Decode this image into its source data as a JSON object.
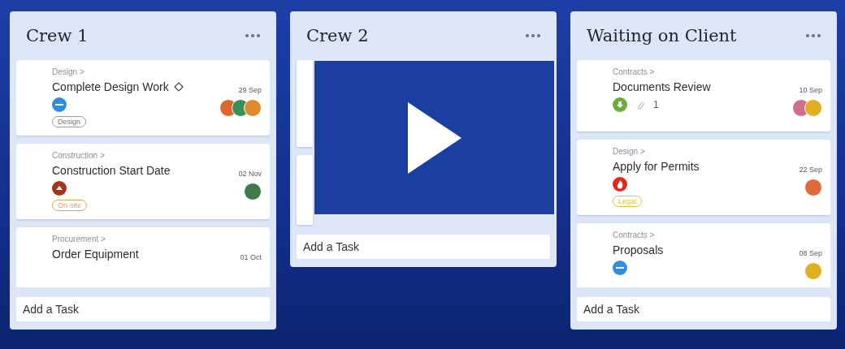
{
  "columns": [
    {
      "title": "Crew 1",
      "clipped": true,
      "cards": [
        {
          "category": "Design >",
          "title": "Complete Design Work",
          "milestone": true,
          "date": "29 Sep",
          "priority": {
            "kind": "minus",
            "color": "#2e8fe0"
          },
          "assignees": [
            {
              "color": "#e0662e"
            },
            {
              "color": "#3b8f5a"
            },
            {
              "color": "#e08a2e"
            }
          ],
          "tag": {
            "label": "Design",
            "color": "#9a9a9a"
          }
        },
        {
          "category": "Construction >",
          "title": "Construction Start Date",
          "date": "02 Nov",
          "priority": {
            "kind": "up",
            "color": "#a8321c"
          },
          "assignees": [
            {
              "color": "#3f7a4a"
            }
          ],
          "tag": {
            "label": "On-site",
            "color": "#e0a060"
          }
        },
        {
          "category": "Procurement >",
          "title": "Order Equipment",
          "date": "01 Oct"
        }
      ],
      "add": {
        "placeholder": "Add a Task"
      }
    },
    {
      "title": "Crew 2",
      "clipped": false,
      "cards": [
        {
          "covered": true
        },
        {
          "covered": true
        }
      ],
      "add": {
        "placeholder": "Add a Task"
      }
    },
    {
      "title": "Waiting on Client",
      "clipped": true,
      "cards": [
        {
          "category": "Contracts >",
          "title": "Documents Review",
          "date": "10 Sep",
          "priority": {
            "kind": "down",
            "color": "#6aad3a"
          },
          "attachments": "1",
          "assignees": [
            {
              "color": "#d0708a"
            },
            {
              "color": "#e0b020"
            }
          ]
        },
        {
          "category": "Design >",
          "title": "Apply for Permits",
          "date": "22 Sep",
          "priority": {
            "kind": "fire",
            "color": "#e02a1a"
          },
          "assignees": [
            {
              "color": "#e06a3a"
            }
          ],
          "tag": {
            "label": "Legal",
            "color": "#e0c040"
          }
        },
        {
          "category": "Contracts >",
          "title": "Proposals",
          "date": "08 Sep",
          "priority": {
            "kind": "minus",
            "color": "#2e8fe0"
          },
          "assignees": [
            {
              "color": "#e0b020"
            }
          ]
        }
      ],
      "add": {
        "placeholder": "Add a Task"
      }
    }
  ],
  "video": {
    "play_button": true
  }
}
